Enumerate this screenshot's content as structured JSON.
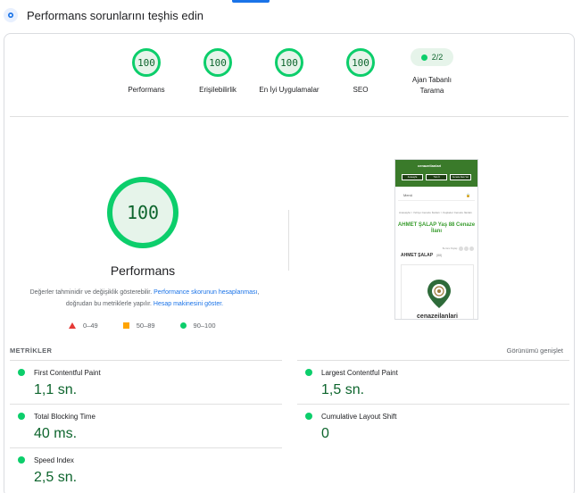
{
  "header": {
    "title": "Performans sorunlarını teşhis edin",
    "icon": "diagnose-icon"
  },
  "categories": [
    {
      "score": "100",
      "label": "Performans"
    },
    {
      "score": "100",
      "label": "Erişilebilirlik"
    },
    {
      "score": "100",
      "label": "En İyi Uygulamalar"
    },
    {
      "score": "100",
      "label": "SEO"
    }
  ],
  "pwa": {
    "score": "2/2",
    "label": "Ajan Tabanlı Tarama"
  },
  "main": {
    "score": "100",
    "label": "Performans",
    "desc_prefix": "Değerler tahminidir ve değişiklik gösterebilir.",
    "desc_link1": "Performance skorunun hesaplanması",
    "desc_mid": ", doğrudan bu metriklerle yapılır.",
    "desc_link2": "Hesap makinesini göster."
  },
  "legend": {
    "fail": "0–49",
    "average": "50–89",
    "pass": "90–100"
  },
  "screenshot": {
    "logo": "cenazeilanlari",
    "buttons": [
      "Anasayfa",
      "Tüm İl",
      "Cenaze İlanı Ver"
    ],
    "menu": "Menü",
    "breadcrumb": "Anasayfa > Yehiyo Cenaze İlanları > Keşkeler Cenaze İlanları",
    "headline": "AHMET ŞALAP Yaş 88 Cenaze İlanı",
    "share_prefix": "Bu ilanı Paylaş:",
    "name": "AHMET ŞALAP",
    "age": "(88)",
    "brand": "cenazeilanlari"
  },
  "metrics": {
    "title": "METRİKLER",
    "expand": "Görünümü genişlet",
    "items": [
      {
        "label": "First Contentful Paint",
        "value": "1,1 sn."
      },
      {
        "label": "Largest Contentful Paint",
        "value": "1,5 sn."
      },
      {
        "label": "Total Blocking Time",
        "value": "40 ms."
      },
      {
        "label": "Cumulative Layout Shift",
        "value": "0"
      },
      {
        "label": "Speed Index",
        "value": "2,5 sn."
      }
    ]
  },
  "colors": {
    "pass": "#0cce6b",
    "pass_text": "#0d652d",
    "average": "#ffa400",
    "fail": "#e53935",
    "link": "#1a73e8"
  }
}
